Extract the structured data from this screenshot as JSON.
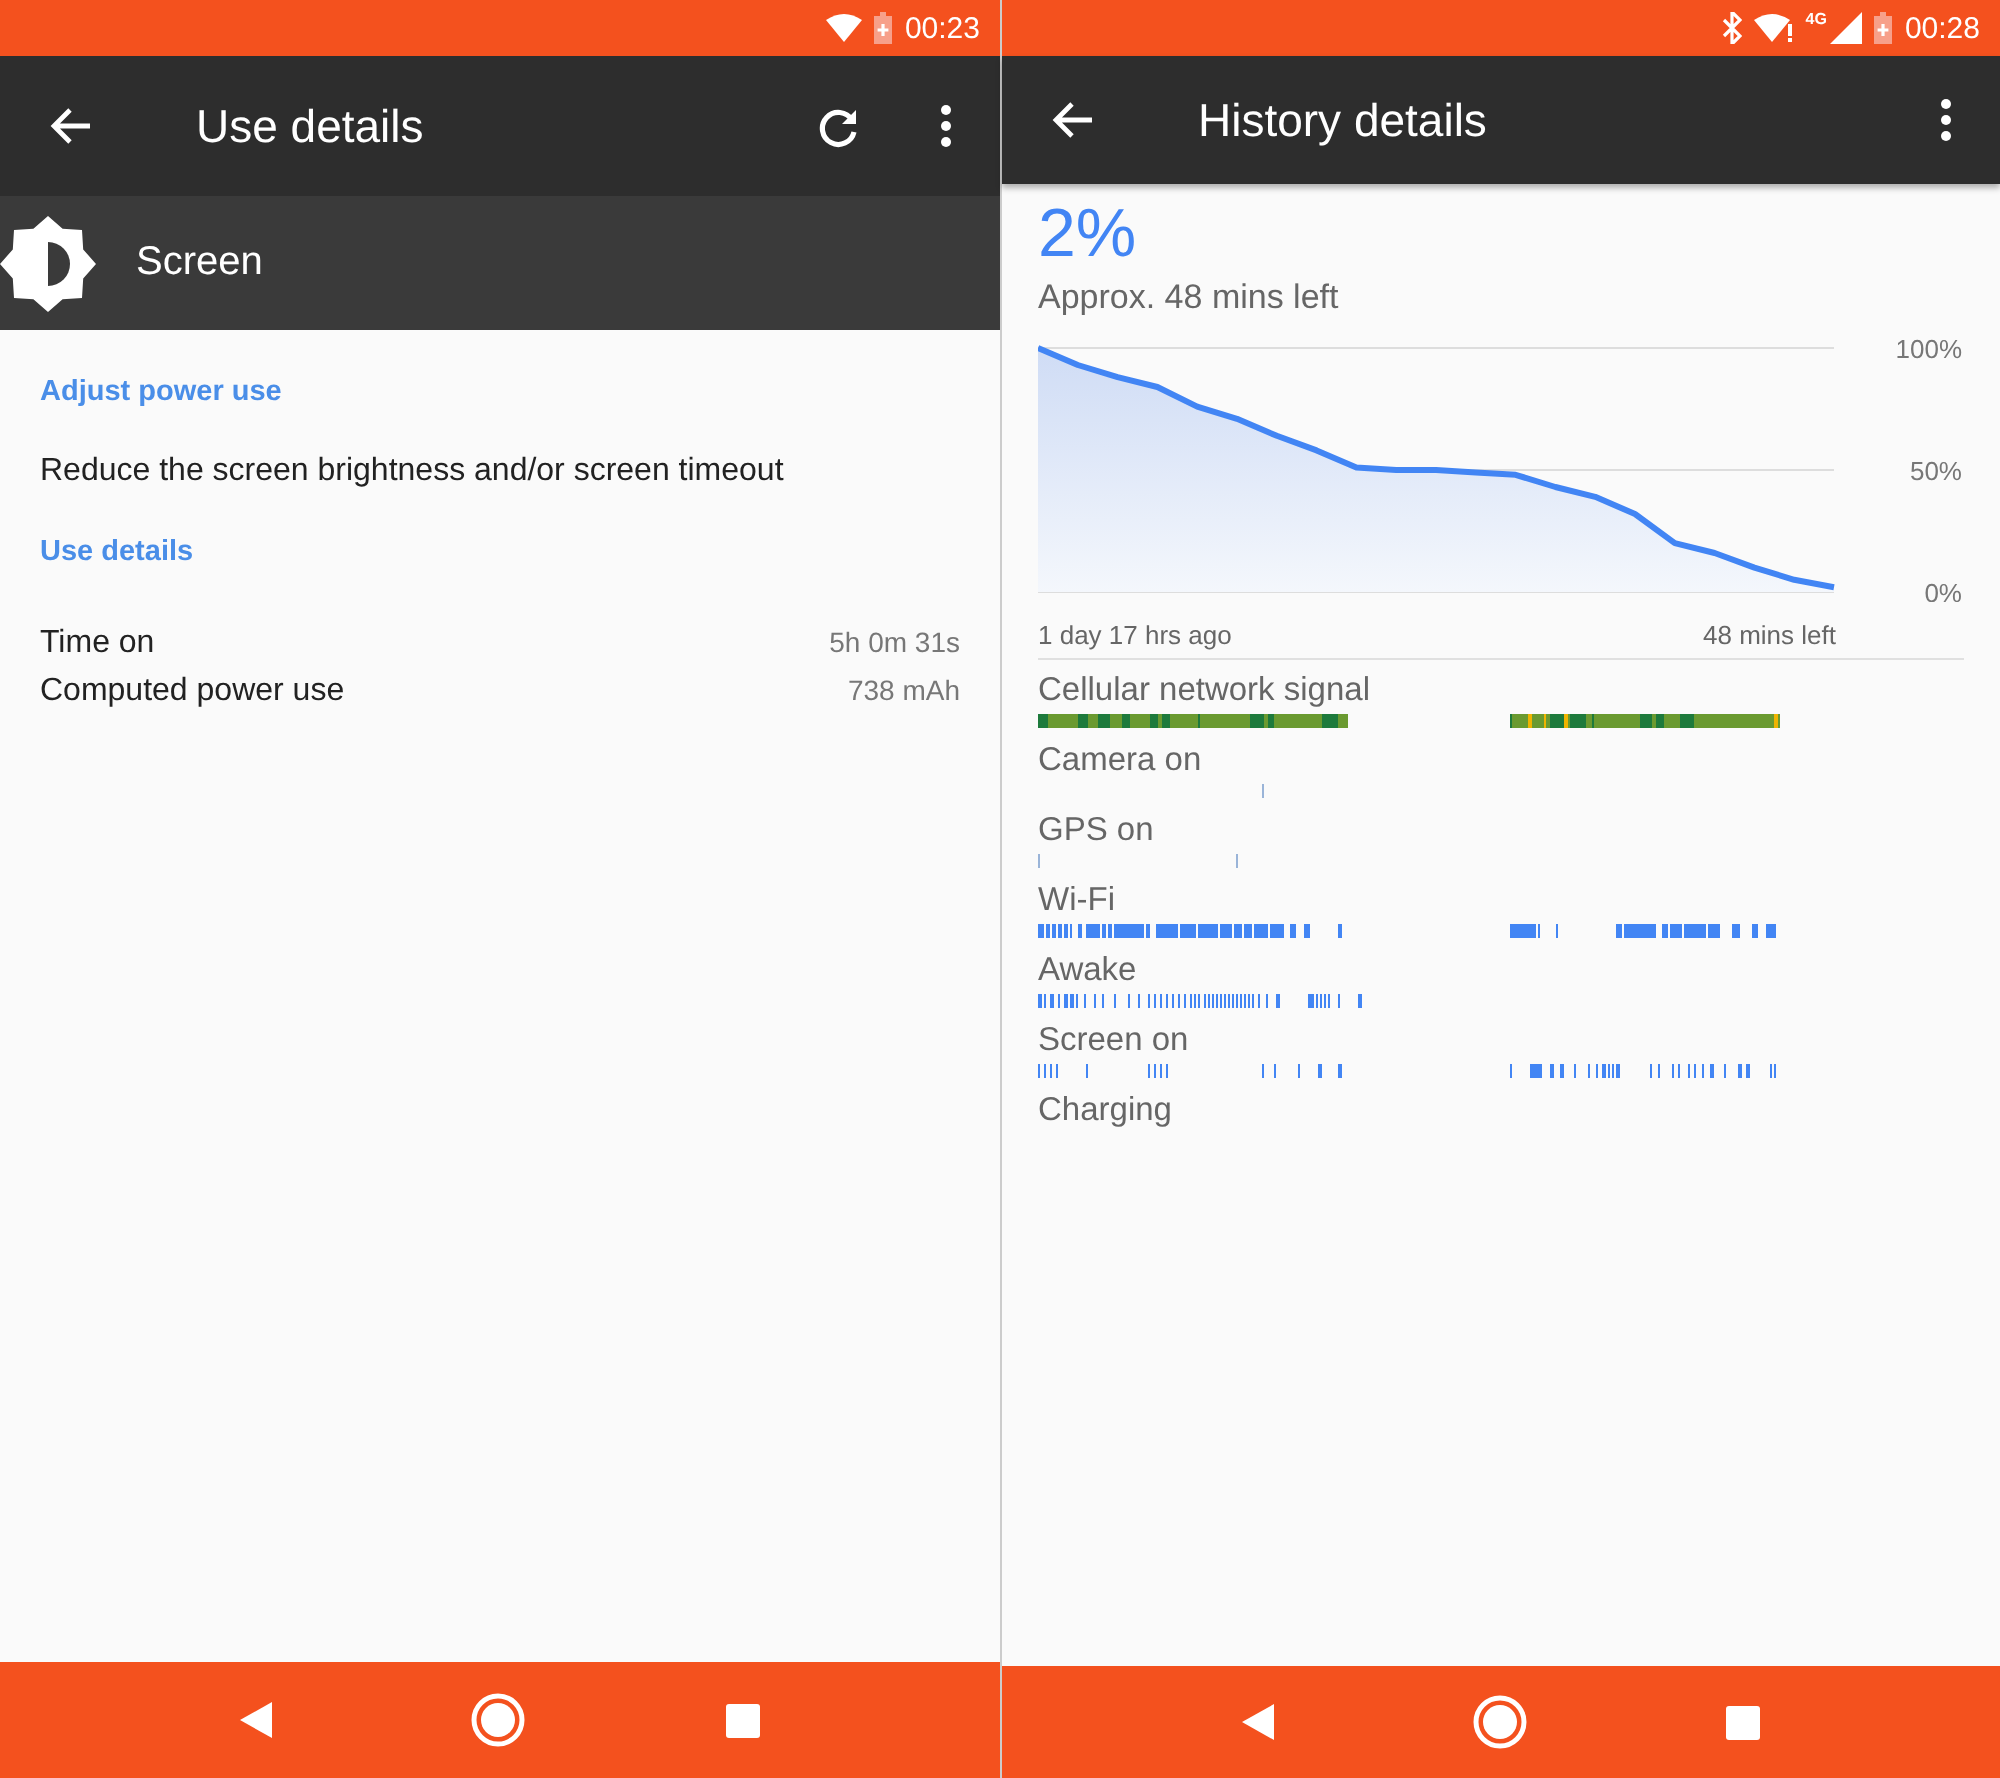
{
  "left_screen": {
    "status_bar": {
      "time": "00:23"
    },
    "toolbar": {
      "title": "Use details"
    },
    "app_header": {
      "title": "Screen"
    },
    "adjust_heading": "Adjust power use",
    "tip": "Reduce the screen brightness and/or screen timeout",
    "details_heading": "Use details",
    "stats": [
      {
        "label": "Time on",
        "value": "5h 0m 31s"
      },
      {
        "label": "Computed power use",
        "value": "738 mAh"
      }
    ]
  },
  "right_screen": {
    "status_bar": {
      "network_type": "4G",
      "time": "00:28"
    },
    "toolbar": {
      "title": "History details"
    },
    "battery": {
      "percent": "2%",
      "estimate": "Approx. 48 mins left"
    },
    "chart_data": {
      "type": "area",
      "series": [
        {
          "color": "#4285f4",
          "values": [
            100,
            93,
            88,
            84,
            76,
            71,
            64,
            58,
            51,
            50,
            50,
            49,
            48,
            43,
            39,
            32,
            20,
            16,
            10,
            5,
            2
          ]
        }
      ],
      "ylim": [
        0,
        100
      ],
      "yticks": [
        {
          "value": 0,
          "label": "0%"
        },
        {
          "value": 50,
          "label": "50%"
        },
        {
          "value": 100,
          "label": "100%"
        }
      ]
    },
    "chart_start": "1 day 17 hrs ago",
    "chart_end": "48 mins left",
    "timelines": [
      {
        "label": "Cellular network signal",
        "kind": "signal"
      },
      {
        "label": "Camera on",
        "kind": "events"
      },
      {
        "label": "GPS on",
        "kind": "events"
      },
      {
        "label": "Wi-Fi",
        "kind": "events"
      },
      {
        "label": "Awake",
        "kind": "events"
      },
      {
        "label": "Screen on",
        "kind": "events"
      },
      {
        "label": "Charging",
        "kind": "none"
      }
    ]
  }
}
